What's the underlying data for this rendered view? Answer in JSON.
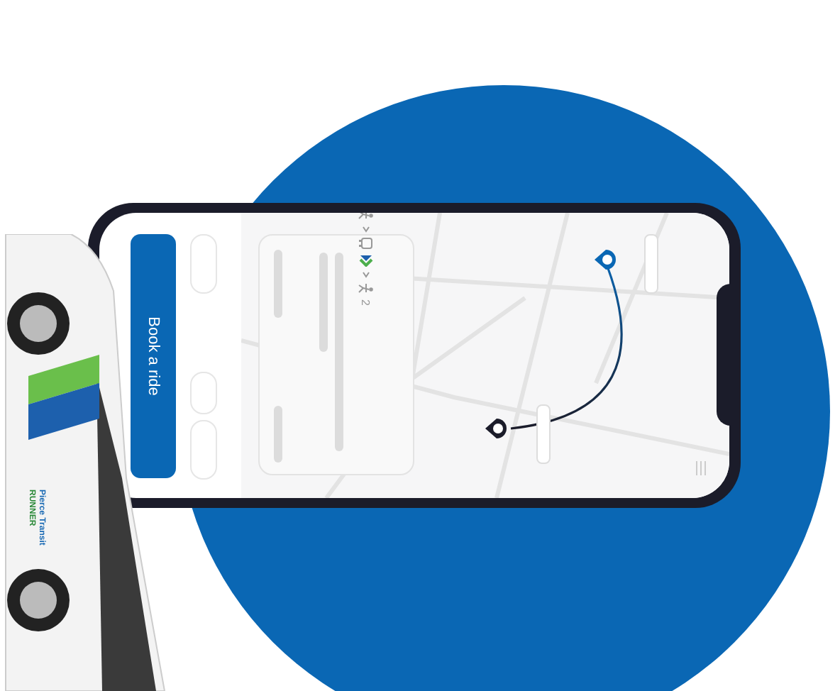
{
  "app_screen": {
    "book_button": "Book a ride",
    "trip_card": {
      "transfers": "2"
    }
  },
  "car": {
    "logo_lines": [
      "Pierce Transit",
      "RUNNER"
    ]
  }
}
